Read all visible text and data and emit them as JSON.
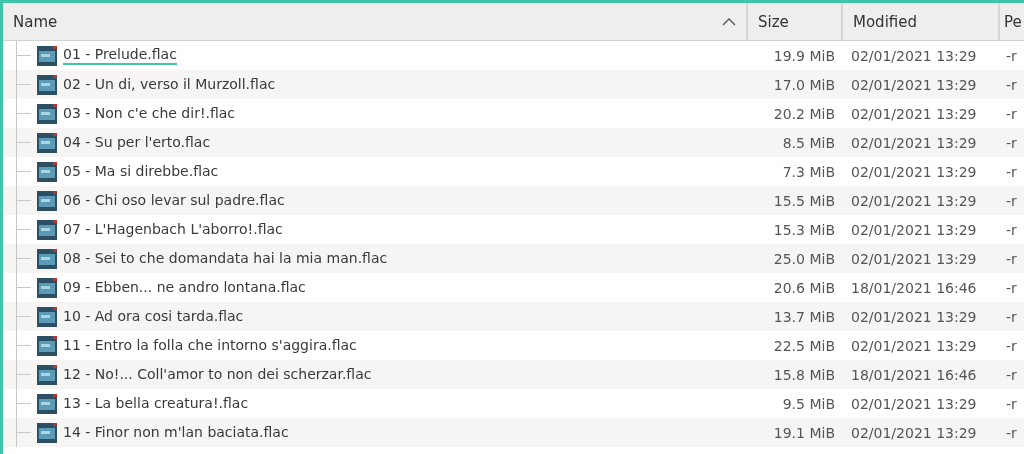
{
  "table": {
    "columns": [
      {
        "label": "Name",
        "sorted": true
      },
      {
        "label": "Size",
        "sorted": false
      },
      {
        "label": "Modified",
        "sorted": false
      },
      {
        "label": "Pe",
        "sorted": false
      }
    ],
    "rows": [
      {
        "name": "01 - Prelude.flac",
        "size": "19.9 MiB",
        "modified": "02/01/2021 13:29",
        "perm": "-r",
        "current": true
      },
      {
        "name": "02 - Un di, verso il Murzoll.flac",
        "size": "17.0 MiB",
        "modified": "02/01/2021 13:29",
        "perm": "-r",
        "current": false
      },
      {
        "name": "03 - Non c'e che dir!.flac",
        "size": "20.2 MiB",
        "modified": "02/01/2021 13:29",
        "perm": "-r",
        "current": false
      },
      {
        "name": "04 - Su per l'erto.flac",
        "size": "8.5 MiB",
        "modified": "02/01/2021 13:29",
        "perm": "-r",
        "current": false
      },
      {
        "name": "05 - Ma si direbbe.flac",
        "size": "7.3 MiB",
        "modified": "02/01/2021 13:29",
        "perm": "-r",
        "current": false
      },
      {
        "name": "06 - Chi oso levar sul padre.flac",
        "size": "15.5 MiB",
        "modified": "02/01/2021 13:29",
        "perm": "-r",
        "current": false
      },
      {
        "name": "07 - L'Hagenbach L'aborro!.flac",
        "size": "15.3 MiB",
        "modified": "02/01/2021 13:29",
        "perm": "-r",
        "current": false
      },
      {
        "name": "08 - Sei to che domandata hai la mia man.flac",
        "size": "25.0 MiB",
        "modified": "02/01/2021 13:29",
        "perm": "-r",
        "current": false
      },
      {
        "name": "09 - Ebben... ne andro lontana.flac",
        "size": "20.6 MiB",
        "modified": "18/01/2021 16:46",
        "perm": "-r",
        "current": false
      },
      {
        "name": "10 - Ad ora cosi tarda.flac",
        "size": "13.7 MiB",
        "modified": "02/01/2021 13:29",
        "perm": "-r",
        "current": false
      },
      {
        "name": "11 - Entro la folla che intorno s'aggira.flac",
        "size": "22.5 MiB",
        "modified": "02/01/2021 13:29",
        "perm": "-r",
        "current": false
      },
      {
        "name": "12 - No!... Coll'amor to non dei scherzar.flac",
        "size": "15.8 MiB",
        "modified": "18/01/2021 16:46",
        "perm": "-r",
        "current": false
      },
      {
        "name": "13 - La bella creatura!.flac",
        "size": "9.5 MiB",
        "modified": "02/01/2021 13:29",
        "perm": "-r",
        "current": false
      },
      {
        "name": "14 - Finor non m'lan baciata.flac",
        "size": "19.1 MiB",
        "modified": "02/01/2021 13:29",
        "perm": "-r",
        "current": false
      }
    ]
  }
}
